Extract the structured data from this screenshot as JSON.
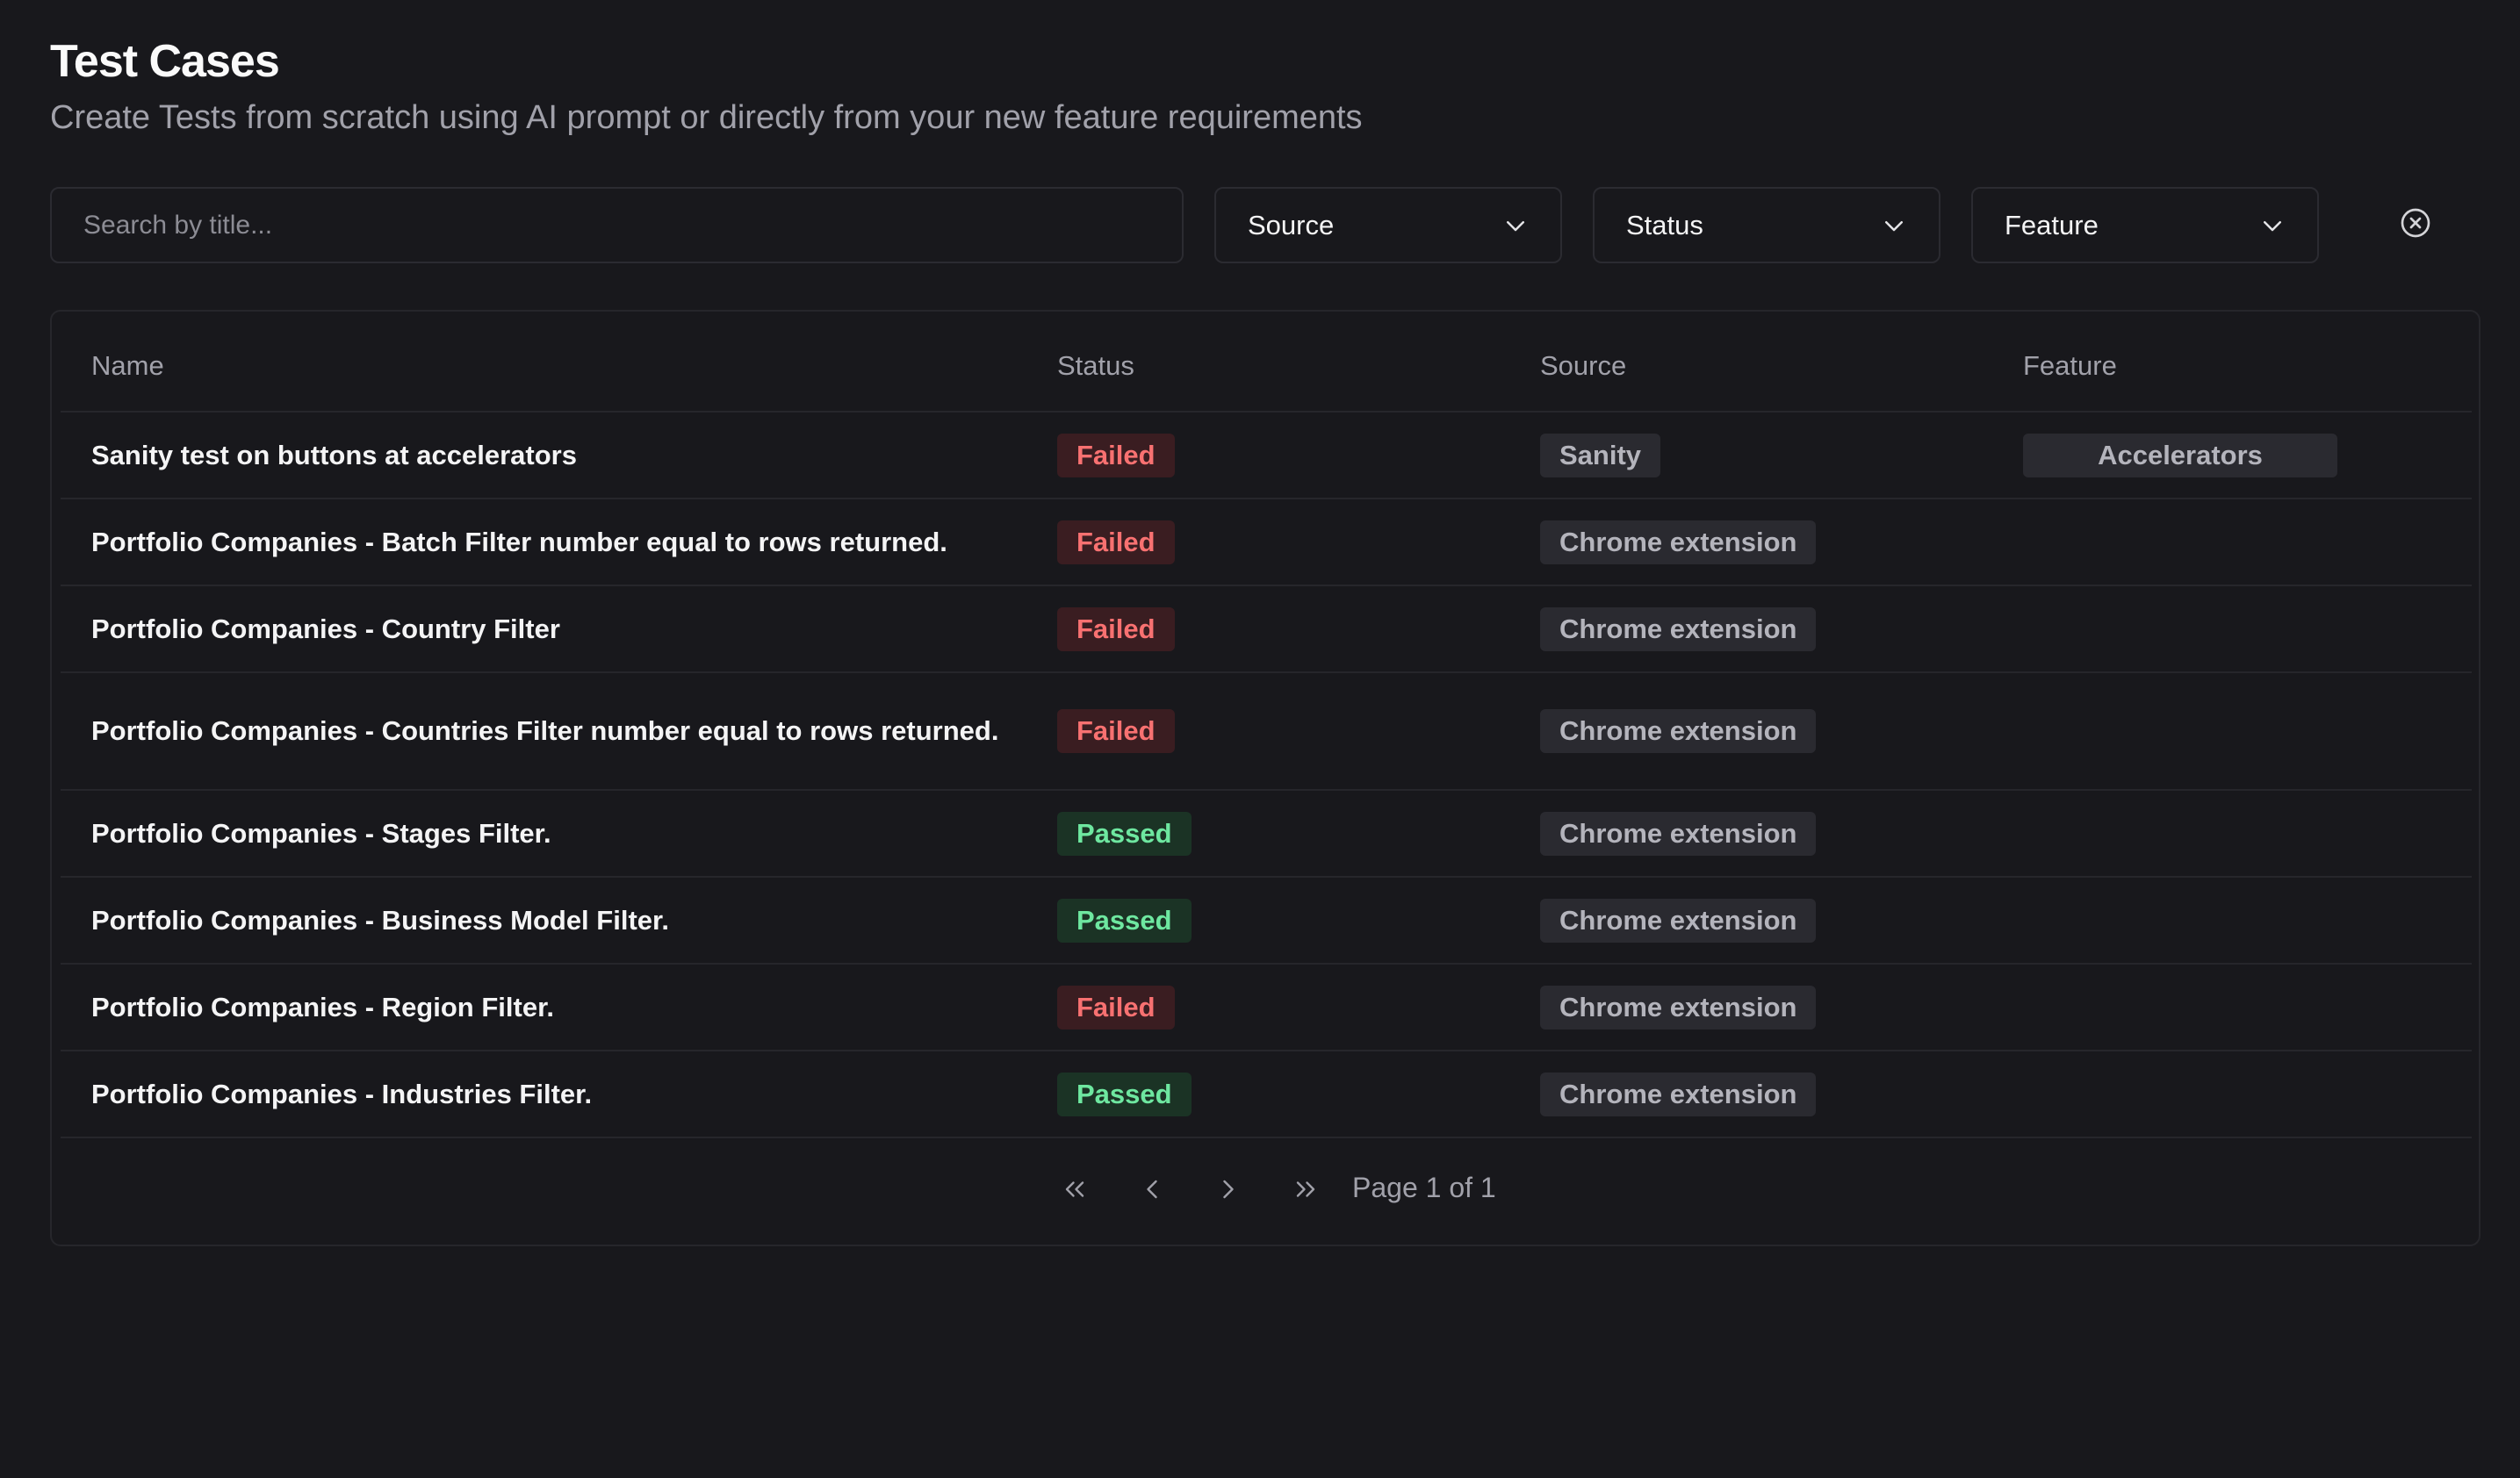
{
  "header": {
    "title": "Test Cases",
    "subtitle": "Create Tests from scratch using AI prompt or directly from your new feature requirements"
  },
  "filters": {
    "search_placeholder": "Search by title...",
    "search_value": "",
    "source_label": "Source",
    "status_label": "Status",
    "feature_label": "Feature",
    "clear_icon": "circle-x-icon"
  },
  "table": {
    "columns": [
      "Name",
      "Status",
      "Source",
      "Feature"
    ],
    "rows": [
      {
        "name": "Sanity test on buttons at accelerators",
        "status": "Failed",
        "source": "Sanity",
        "feature": "Accelerators"
      },
      {
        "name": "Portfolio Companies - Batch Filter number equal to rows returned.",
        "status": "Failed",
        "source": "Chrome extension",
        "feature": ""
      },
      {
        "name": "Portfolio Companies - Country Filter",
        "status": "Failed",
        "source": "Chrome extension",
        "feature": ""
      },
      {
        "name": "Portfolio Companies - Countries Filter number equal to rows returned.",
        "status": "Failed",
        "source": "Chrome extension",
        "feature": ""
      },
      {
        "name": "Portfolio Companies - Stages Filter.",
        "status": "Passed",
        "source": "Chrome extension",
        "feature": ""
      },
      {
        "name": "Portfolio Companies - Business Model Filter.",
        "status": "Passed",
        "source": "Chrome extension",
        "feature": ""
      },
      {
        "name": "Portfolio Companies - Region Filter.",
        "status": "Failed",
        "source": "Chrome extension",
        "feature": ""
      },
      {
        "name": "Portfolio Companies - Industries Filter.",
        "status": "Passed",
        "source": "Chrome extension",
        "feature": ""
      }
    ]
  },
  "pagination": {
    "page_info": "Page 1 of 1"
  },
  "colors": {
    "background": "#18181c",
    "failed_text": "#f87171",
    "failed_bg": "#3a1d21",
    "passed_text": "#6ee7a0",
    "passed_bg": "#1b3325"
  }
}
